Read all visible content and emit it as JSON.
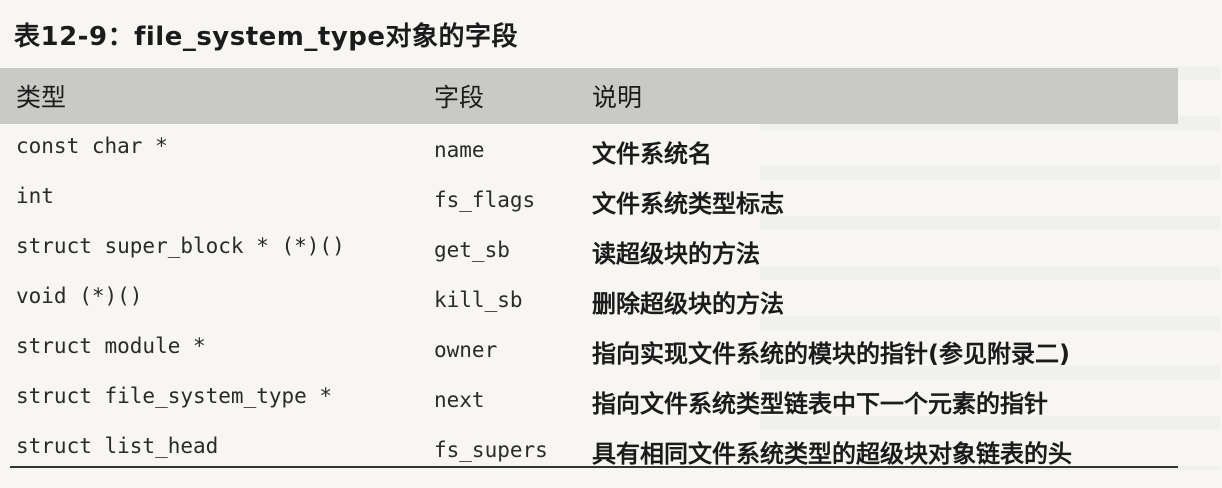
{
  "title": "表12-9：file_system_type对象的字段",
  "columns": [
    "类型",
    "字段",
    "说明"
  ],
  "rows": [
    {
      "type": "const char *",
      "field": "name",
      "desc": "文件系统名"
    },
    {
      "type": "int",
      "field": "fs_flags",
      "desc": "文件系统类型标志"
    },
    {
      "type": "struct super_block * (*)()",
      "field": "get_sb",
      "desc": "读超级块的方法"
    },
    {
      "type": "void (*)()",
      "field": "kill_sb",
      "desc": "删除超级块的方法"
    },
    {
      "type": "struct module *",
      "field": "owner",
      "desc": "指向实现文件系统的模块的指针(参见附录二)"
    },
    {
      "type": "struct file_system_type *",
      "field": "next",
      "desc": "指向文件系统类型链表中下一个元素的指针"
    },
    {
      "type": "struct list_head",
      "field": "fs_supers",
      "desc": "具有相同文件系统类型的超级块对象链表的头"
    }
  ]
}
